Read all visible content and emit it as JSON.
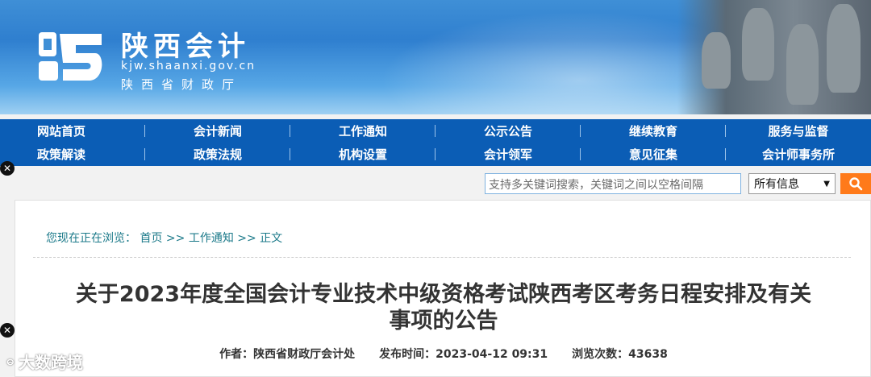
{
  "header": {
    "title": "陕西会计",
    "url": "kjw.shaanxi.gov.cn",
    "subtitle": "陕西省财政厅"
  },
  "nav": {
    "row1": [
      "网站首页",
      "会计新闻",
      "工作通知",
      "公示公告",
      "继续教育",
      "服务与监督"
    ],
    "row2": [
      "政策解读",
      "政策法规",
      "机构设置",
      "会计领军",
      "意见征集",
      "会计师事务所"
    ]
  },
  "search": {
    "placeholder": "支持多关键词搜索，关键词之间以空格间隔",
    "scope": "所有信息"
  },
  "breadcrumb": {
    "prefix": "您现在正在浏览：",
    "path": "首页 >> 工作通知 >> 正文"
  },
  "article": {
    "title_line1": "关于2023年度全国会计专业技术中级资格考试陕西考区考务日程安排及有关",
    "title_line2": "事项的公告",
    "author_label": "作者：",
    "author": "陕西省财政厅会计处",
    "date_label": "发布时间：",
    "date": "2023-04-12 09:31",
    "views_label": "浏览次数：",
    "views": "43638"
  },
  "watermark": {
    "text": "大数跨境"
  },
  "colors": {
    "nav_bg": "#0b5db5",
    "search_button": "#ff7a1a",
    "breadcrumb": "#1c7a8a"
  }
}
